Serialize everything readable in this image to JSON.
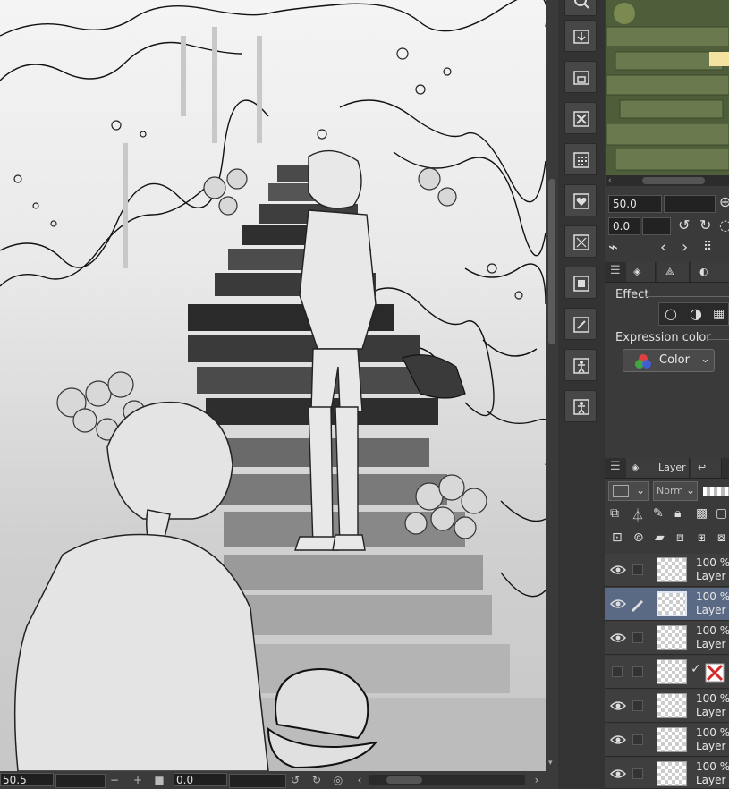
{
  "status_bar": {
    "zoom_value": "50.5",
    "zoom_out": "−",
    "zoom_in": "+",
    "rotation_value": "0.0"
  },
  "navigator": {
    "zoom_value": "50.0",
    "rotation_value": "0.0"
  },
  "tool_property": {
    "effect_label": "Effect",
    "expression_color_label": "Expression color",
    "expression_color_value": "Color"
  },
  "layer_panel": {
    "tab_label": "Layer",
    "blend_mode": "Norm",
    "layers": [
      {
        "opacity": "100 %",
        "name": "Layer",
        "selected": false,
        "visible": true
      },
      {
        "opacity": "100 %",
        "name": "Layer",
        "selected": true,
        "visible": true,
        "editing": true
      },
      {
        "opacity": "100 %",
        "name": "Layer",
        "selected": false,
        "visible": true
      },
      {
        "opacity": "",
        "name": "",
        "selected": false,
        "visible": false,
        "mask_disabled": true
      },
      {
        "opacity": "100 %",
        "name": "Layer",
        "selected": false,
        "visible": true
      },
      {
        "opacity": "100 %",
        "name": "Layer",
        "selected": false,
        "visible": true
      },
      {
        "opacity": "100 %",
        "name": "Layer",
        "selected": false,
        "visible": true
      }
    ]
  },
  "command_bar": {
    "icons": [
      "search-icon",
      "export-icon",
      "save-icon",
      "close-icon",
      "grid-icon",
      "favorite-icon",
      "transform-icon",
      "image-icon",
      "edit-icon",
      "person-icon",
      "person-frame-icon"
    ]
  },
  "colors": {
    "panel_bg": "#3a3a3a",
    "selected_layer": "#5a6a85",
    "accent_red": "#d42a2a"
  }
}
